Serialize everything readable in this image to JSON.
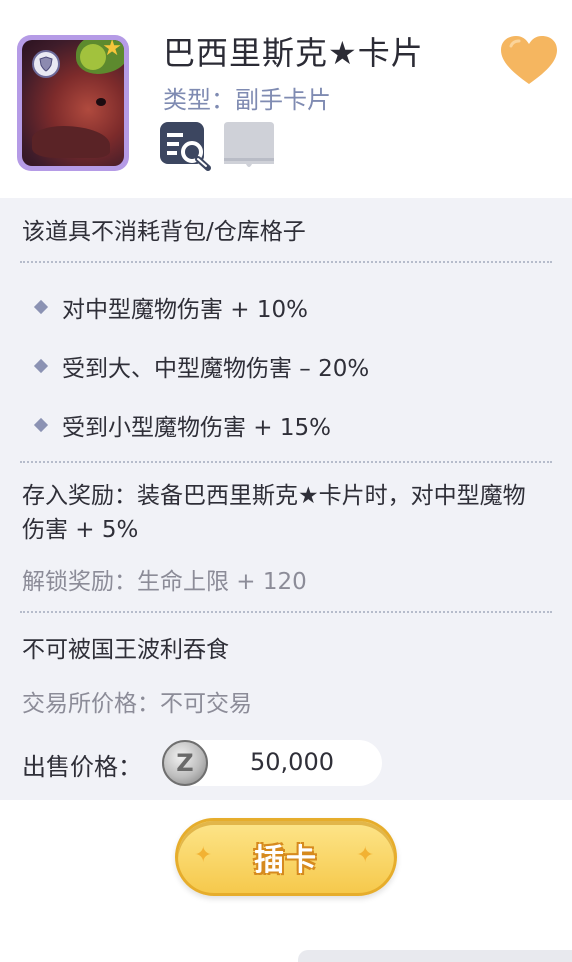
{
  "header": {
    "name": "巴西里斯克★卡片",
    "type_line": "类型：副手卡片",
    "icons": {
      "card_badge": "shield-icon",
      "favorite": "heart-icon",
      "preview": "preview-search-icon",
      "collection": "book-icon"
    },
    "colors": {
      "heart": "#f5b660",
      "card_frame": "#b59be6",
      "type_text": "#7f8bb2"
    }
  },
  "info": {
    "storage_note": "该道具不消耗背包/仓库格子",
    "stats": [
      "对中型魔物伤害 + 10%",
      "受到大、中型魔物伤害 – 20%",
      "受到小型魔物伤害 + 15%"
    ],
    "deposit_reward": "存入奖励：装备巴西里斯克★卡片时，对中型魔物伤害 + 5%",
    "unlock_reward": "解锁奖励：生命上限 + 120",
    "restriction": "不可被国王波利吞食",
    "exchange_price": "交易所价格：不可交易",
    "sell_label": "出售价格：",
    "coin_symbol": "Z",
    "sell_value": "50,000"
  },
  "actions": {
    "insert_label": "插卡"
  }
}
